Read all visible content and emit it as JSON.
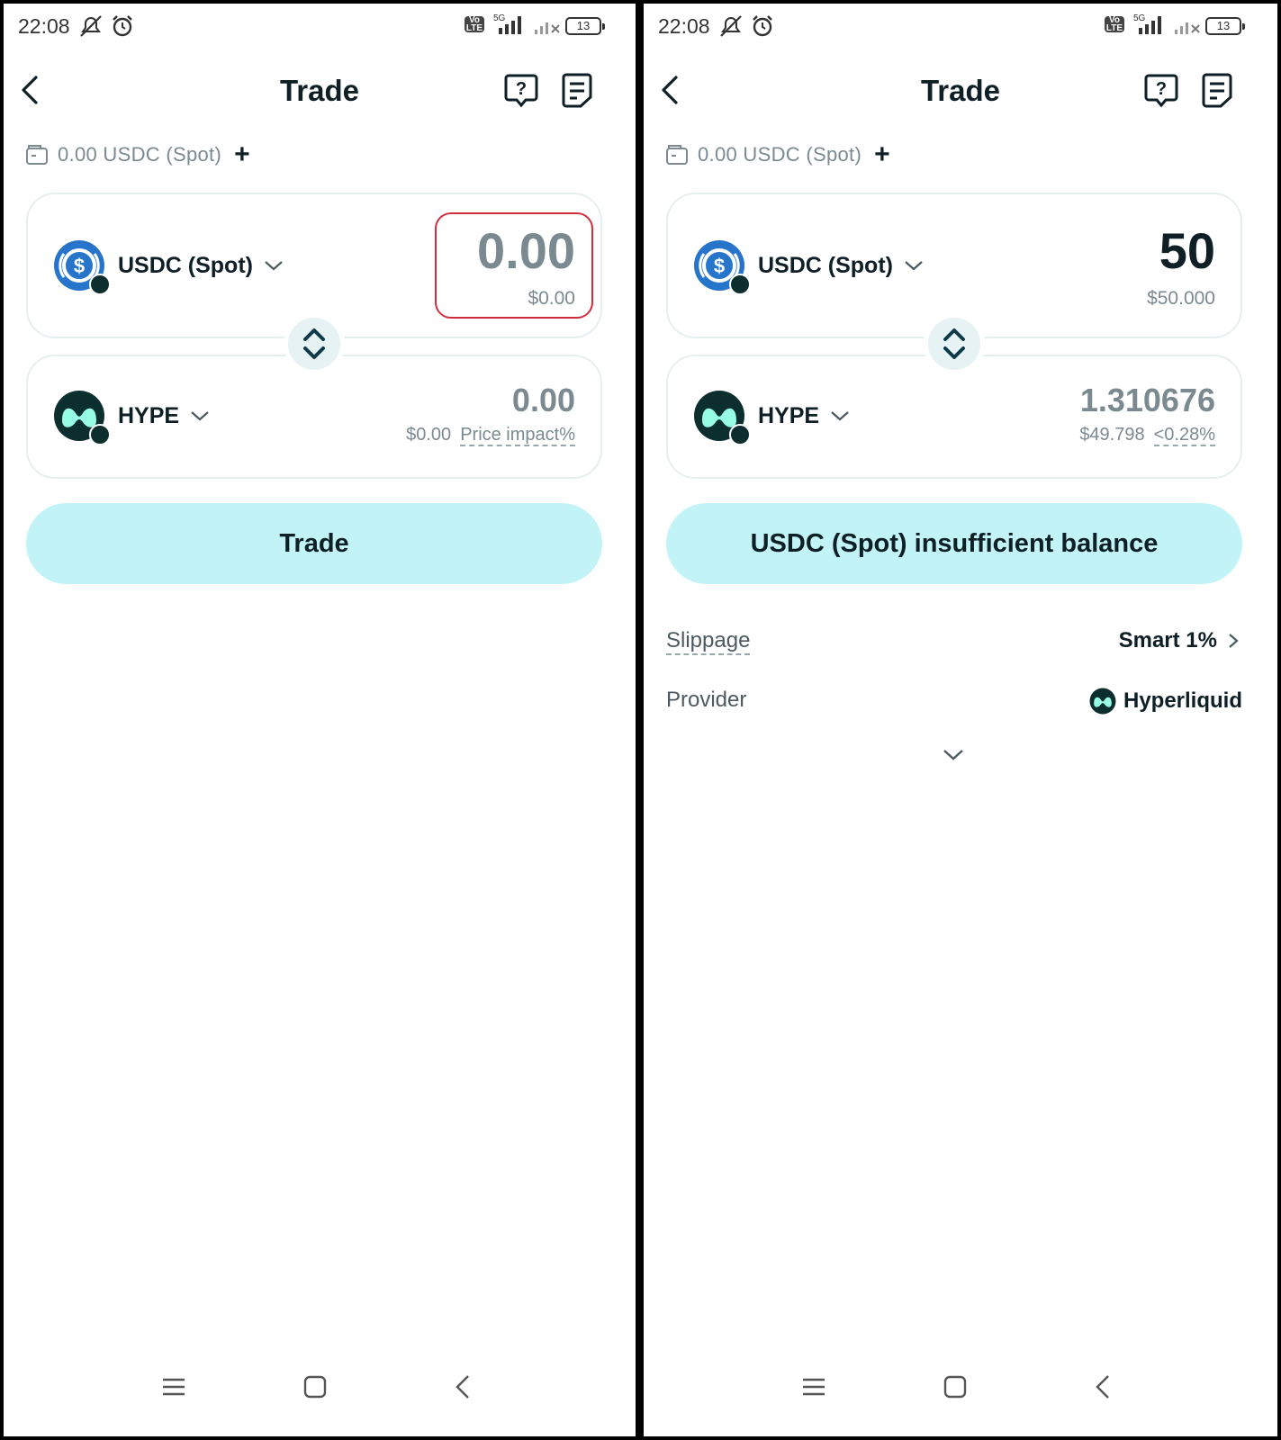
{
  "screens": {
    "left": {
      "status_time": "22:08",
      "battery": "13",
      "title": "Trade",
      "balance_text": "0.00 USDC (Spot)",
      "add_symbol": "+",
      "from_token": {
        "name": "USDC (Spot)",
        "amount": "0.00",
        "usd": "$0.00"
      },
      "to_token": {
        "name": "HYPE",
        "amount": "0.00",
        "usd": "$0.00",
        "impact": "Price impact%"
      },
      "action_button": "Trade"
    },
    "right": {
      "status_time": "22:08",
      "battery": "13",
      "title": "Trade",
      "balance_text": "0.00 USDC (Spot)",
      "add_symbol": "+",
      "from_token": {
        "name": "USDC (Spot)",
        "amount": "50",
        "usd": "$50.000"
      },
      "to_token": {
        "name": "HYPE",
        "amount": "1.310676",
        "usd": "$49.798",
        "impact": "<0.28%"
      },
      "action_button": "USDC (Spot) insufficient balance",
      "slippage": {
        "label": "Slippage",
        "value": "Smart 1%"
      },
      "provider": {
        "label": "Provider",
        "value": "Hyperliquid"
      }
    }
  },
  "icons": {
    "back": "back-arrow-icon",
    "help": "help-icon",
    "orders": "orders-icon",
    "wallet": "wallet-icon",
    "swap": "swap-direction-icon",
    "usdc_logo": "usdc-logo-icon",
    "hype_logo": "hype-logo-icon",
    "chevron": "chevron-down-icon"
  },
  "colors": {
    "accent_button": "#c2f4f7",
    "highlight_border": "#d22d3d",
    "usdc_blue": "#2775ca",
    "hype_dark": "#0c2e2e",
    "hype_mint": "#97fce4"
  }
}
